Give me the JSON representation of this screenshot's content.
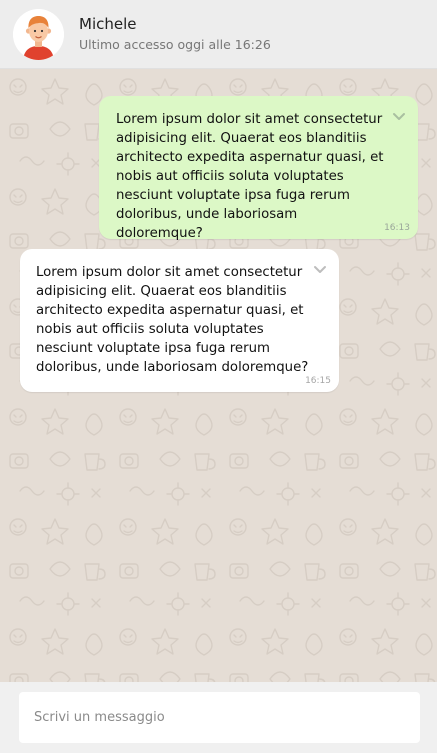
{
  "header": {
    "contact_name": "Michele",
    "last_seen": "Ultimo accesso oggi alle 16:26",
    "avatar_icon": "user-avatar-icon"
  },
  "messages": [
    {
      "direction": "sent",
      "text": "Lorem ipsum dolor sit amet consectetur adipisicing elit. Quaerat eos blanditiis architecto expedita aspernatur quasi, et nobis aut officiis soluta voluptates nesciunt voluptate ipsa fuga rerum doloribus, unde laboriosam doloremque?",
      "time": "16:13",
      "menu_icon": "chevron-down-icon"
    },
    {
      "direction": "received",
      "text": "Lorem ipsum dolor sit amet consectetur adipisicing elit. Quaerat eos blanditiis architecto expedita aspernatur quasi, et nobis aut officiis soluta voluptates nesciunt voluptate ipsa fuga rerum doloribus, unde laboriosam doloremque?",
      "time": "16:15",
      "menu_icon": "chevron-down-icon"
    }
  ],
  "composer": {
    "placeholder": "Scrivi un messaggio",
    "value": ""
  },
  "colors": {
    "header_bg": "#ededed",
    "chat_bg": "#e5ddd5",
    "sent_bubble": "#dcf8c6",
    "received_bubble": "#ffffff",
    "footer_bg": "#f0f0f0"
  }
}
